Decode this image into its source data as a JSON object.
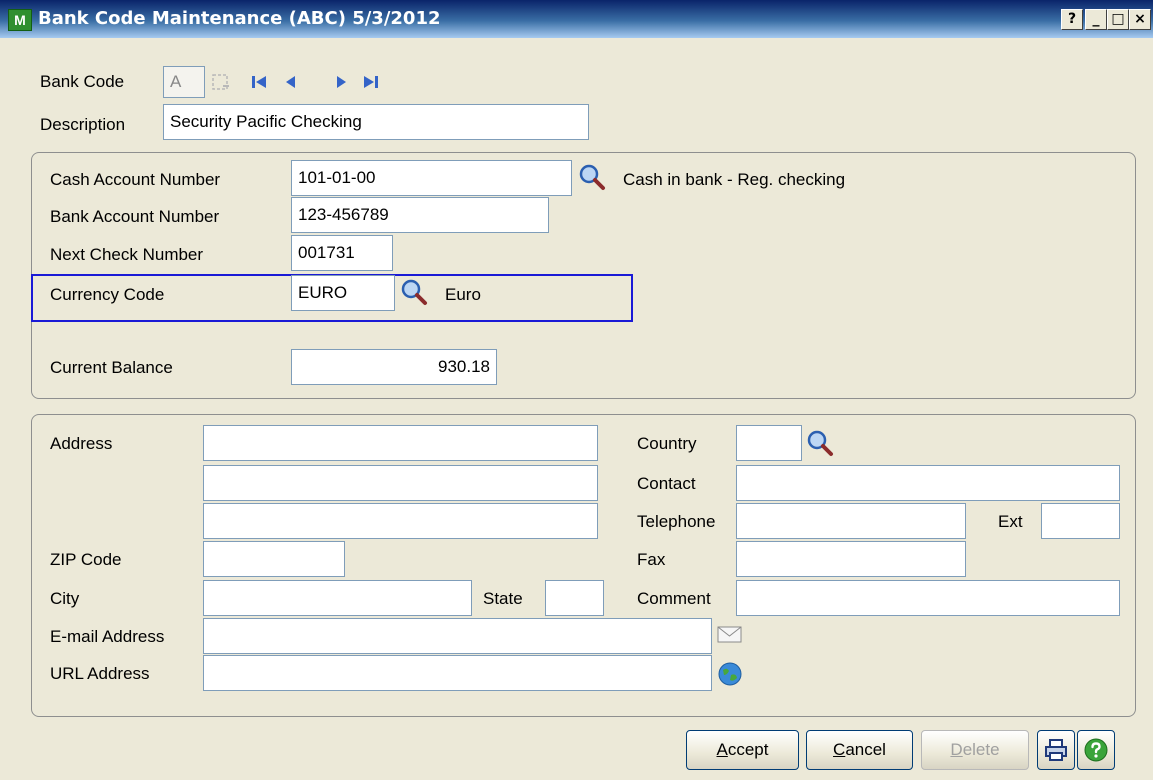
{
  "window": {
    "title": "Bank Code Maintenance (ABC) 5/3/2012",
    "icon": "sage-mas-app-icon",
    "icon_text": "M",
    "controls": {
      "help": "?",
      "minimize": "_",
      "maximize": "□",
      "close": "×"
    }
  },
  "header": {
    "bank_code_label": "Bank Code",
    "bank_code_value": "A",
    "description_label": "Description",
    "description_value": "Security Pacific Checking"
  },
  "account": {
    "cash_account_label": "Cash Account Number",
    "cash_account_value": "101-01-00",
    "cash_account_desc": "Cash in bank - Reg. checking",
    "bank_account_label": "Bank Account Number",
    "bank_account_value": "123-456789",
    "next_check_label": "Next Check Number",
    "next_check_value": "001731",
    "currency_label": "Currency Code",
    "currency_value": "EURO",
    "currency_desc": "Euro",
    "balance_label": "Current Balance",
    "balance_value": "930.18"
  },
  "address": {
    "address_label": "Address",
    "address_line1": "",
    "address_line2": "",
    "address_line3": "",
    "zip_label": "ZIP Code",
    "zip_value": "",
    "city_label": "City",
    "city_value": "",
    "state_label": "State",
    "state_value": "",
    "email_label": "E-mail Address",
    "email_value": "",
    "url_label": "URL Address",
    "url_value": "",
    "country_label": "Country",
    "country_value": "",
    "contact_label": "Contact",
    "contact_value": "",
    "telephone_label": "Telephone",
    "telephone_value": "",
    "ext_label": "Ext",
    "ext_value": "",
    "fax_label": "Fax",
    "fax_value": "",
    "comment_label": "Comment",
    "comment_value": ""
  },
  "buttons": {
    "accept_accel": "A",
    "accept_rest": "ccept",
    "cancel_accel": "C",
    "cancel_rest": "ancel",
    "delete_accel": "D",
    "delete_rest": "elete"
  },
  "colors": {
    "title_gradient_start": "#0a246a",
    "highlight_border": "#1a1ad6",
    "dialog_background": "#ece9d8"
  }
}
